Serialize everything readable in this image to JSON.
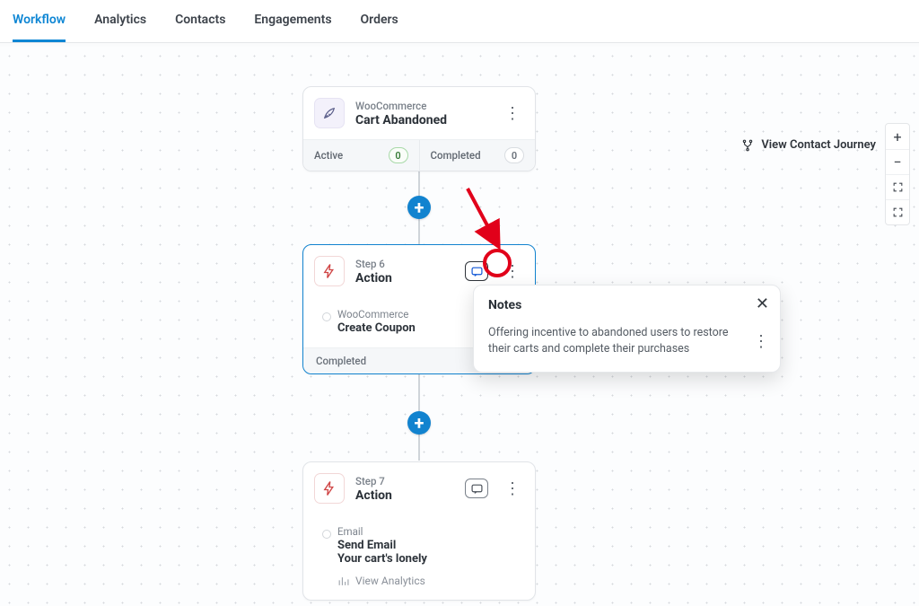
{
  "tabs": [
    {
      "label": "Workflow",
      "active": true
    },
    {
      "label": "Analytics"
    },
    {
      "label": "Contacts"
    },
    {
      "label": "Engagements"
    },
    {
      "label": "Orders"
    }
  ],
  "view_journey_label": "View Contact Journey",
  "trigger": {
    "provider": "WooCommerce",
    "title": "Cart Abandoned",
    "active_label": "Active",
    "active_count": "0",
    "completed_label": "Completed",
    "completed_count": "0"
  },
  "step6": {
    "step_label": "Step 6",
    "title": "Action",
    "provider": "WooCommerce",
    "action_name": "Create Coupon",
    "footer": "Completed"
  },
  "step7": {
    "step_label": "Step 7",
    "title": "Action",
    "provider": "Email",
    "action_name": "Send Email",
    "subject": "Your cart's lonely",
    "analytics_label": "View Analytics"
  },
  "notes": {
    "heading": "Notes",
    "text": "Offering incentive to abandoned users to restore their carts and complete their purchases"
  }
}
